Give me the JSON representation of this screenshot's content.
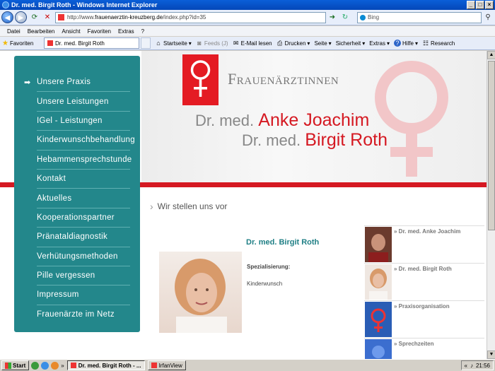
{
  "window": {
    "title": "Dr. med. Birgit Roth - Windows Internet Explorer"
  },
  "address": {
    "prefix": "http://www.",
    "domain": "frauenaerztin-kreuzberg.de",
    "path": "/index.php?id=35"
  },
  "search": {
    "placeholder": "Bing"
  },
  "menu": [
    "Datei",
    "Bearbeiten",
    "Ansicht",
    "Favoriten",
    "Extras",
    "?"
  ],
  "favorites": {
    "label": "Favoriten"
  },
  "tab": {
    "label": "Dr. med. Birgit Roth"
  },
  "commands": {
    "home": "Startseite",
    "feeds": "Feeds (J)",
    "mail": "E-Mail lesen",
    "print": "Drucken",
    "page": "Seite",
    "security": "Sicherheit",
    "tools": "Extras",
    "help": "Hilfe",
    "research": "Research"
  },
  "site": {
    "logo_title": "Frauenärztinnen",
    "doctor1_prefix": "Dr. med.",
    "doctor1_name": "Anke Joachim",
    "doctor2_prefix": "Dr. med.",
    "doctor2_name": "Birgit Roth",
    "nav": [
      "Unsere Praxis",
      "Unsere Leistungen",
      "IGel - Leistungen",
      "Kinderwunschbehandlung",
      "Hebammensprechstunde",
      "Kontakt",
      "Aktuelles",
      "Kooperationspartner",
      "Pränataldiagnostik",
      "Verhütungsmethoden",
      "Pille vergessen",
      "Impressum",
      "Frauenärzte im Netz"
    ],
    "section_title": "Wir stellen uns vor",
    "person_name": "Dr. med. Birgit Roth",
    "spec_label": "Spezialisierung:",
    "spec_value": "Kinderwunsch",
    "right_list": [
      "» Dr. med. Anke Joachim",
      "» Dr. med. Birgit Roth",
      "» Praxisorganisation",
      "» Sprechzeiten"
    ]
  },
  "taskbar": {
    "start": "Start",
    "task1": "Dr. med. Birgit Roth - ...",
    "task2": "IrfanView",
    "clock": "21:56"
  },
  "colors": {
    "teal": "#23878b",
    "red": "#d51922",
    "name_teal": "#1f7f85"
  }
}
